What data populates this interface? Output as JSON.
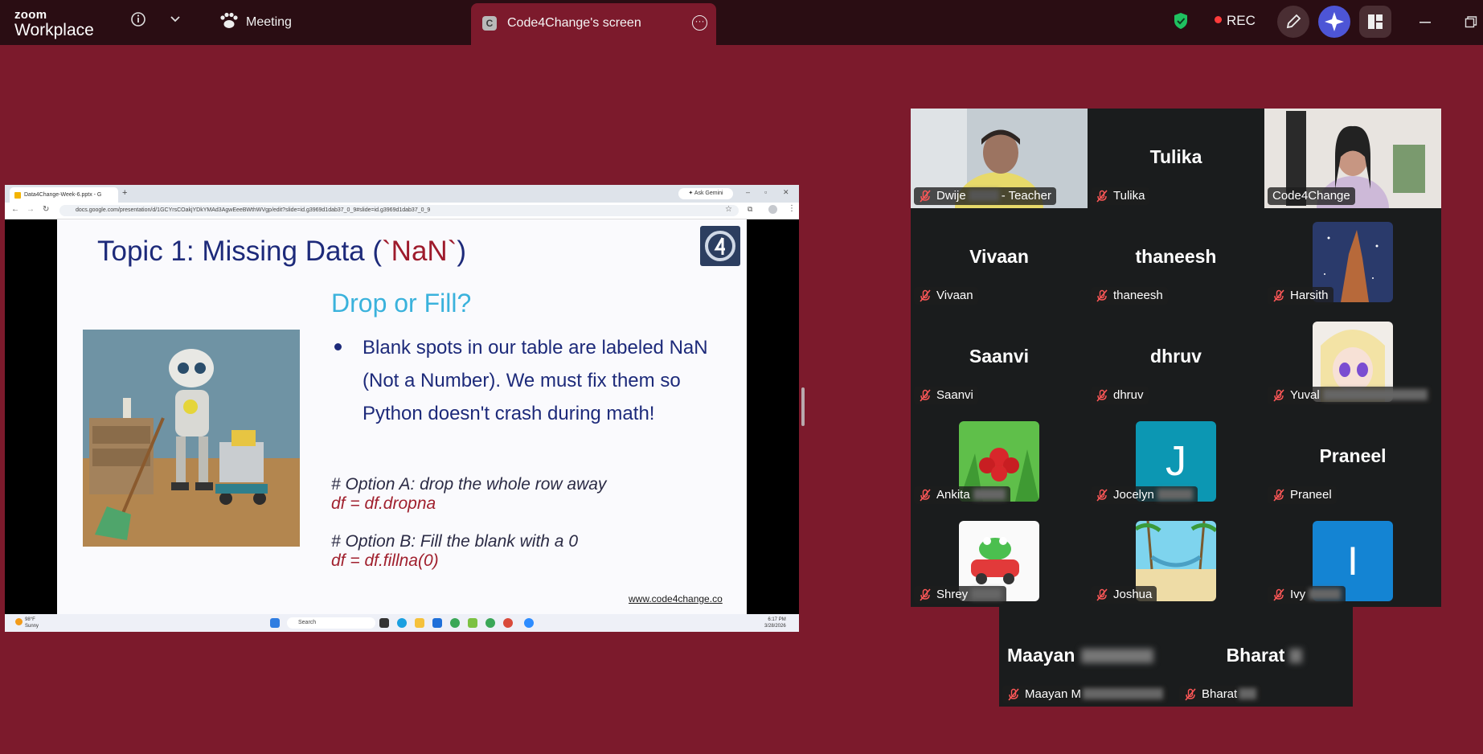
{
  "app": {
    "brand_top": "zoom",
    "brand_bottom": "Workplace"
  },
  "topbar": {
    "meeting_label": "Meeting",
    "share_tab_badge": "C",
    "share_tab_label": "Code4Change's screen",
    "rec_label": "REC"
  },
  "browser": {
    "tab_title": "Data4Change-Week-6.pptx - G",
    "new_tab": "+",
    "ask_gemini": "Ask Gemini",
    "url": "docs.google.com/presentation/d/1GCYrsCOakjYDkYMAd3AgwEeeBWthWVgp/edit?slide=id.g3969d1dab37_0_9#slide=id.g3969d1dab37_0_9"
  },
  "slide": {
    "title_prefix": "Topic 1: Missing Data (",
    "title_nan": "`NaN`",
    "title_suffix": ")",
    "subtitle": "Drop or Fill?",
    "bullet": "Blank spots in our table are labeled NaN (Not a Number). We must fix them so Python doesn't crash during math!",
    "code_a_comment": "# Option A: drop the whole row away",
    "code_a_line": "df = df.dropna",
    "code_b_comment": "# Option B: Fill the blank with a 0",
    "code_b_line": "df = df.fillna(0)",
    "url": "www.code4change.co"
  },
  "taskbar": {
    "weather_temp": "98°F",
    "weather_desc": "Sunny",
    "search": "Search",
    "time": "6:17 PM",
    "date": "3/28/2026"
  },
  "participants": [
    {
      "name": "Dwije",
      "name_suffix": "- Teacher",
      "big": ""
    },
    {
      "name": "Tulika",
      "big": "Tulika"
    },
    {
      "name": "Code4Change",
      "big": ""
    },
    {
      "name": "Vivaan",
      "big": "Vivaan"
    },
    {
      "name": "thaneesh",
      "big": "thaneesh"
    },
    {
      "name": "Harsith",
      "big": ""
    },
    {
      "name": "Saanvi",
      "big": "Saanvi"
    },
    {
      "name": "dhruv",
      "big": "dhruv"
    },
    {
      "name": "Yuval",
      "big": ""
    },
    {
      "name": "Ankita",
      "big": ""
    },
    {
      "name": "Jocelyn",
      "big": "",
      "avatar_letter": "J"
    },
    {
      "name": "Praneel",
      "big": "Praneel"
    },
    {
      "name": "Shrey",
      "big": ""
    },
    {
      "name": "Joshua",
      "big": ""
    },
    {
      "name": "Ivy",
      "big": "",
      "avatar_letter": "I"
    },
    {
      "name": "Maayan M",
      "big": "Maayan"
    },
    {
      "name": "Bharat",
      "big": "Bharat"
    }
  ],
  "colors": {
    "background": "#7c1a2c",
    "topbar": "#2a0d13",
    "active_speaker": "#2fe07a",
    "slide_title": "#1d2a7a",
    "slide_subtitle": "#3ab2dc",
    "code_red": "#a0202e"
  }
}
